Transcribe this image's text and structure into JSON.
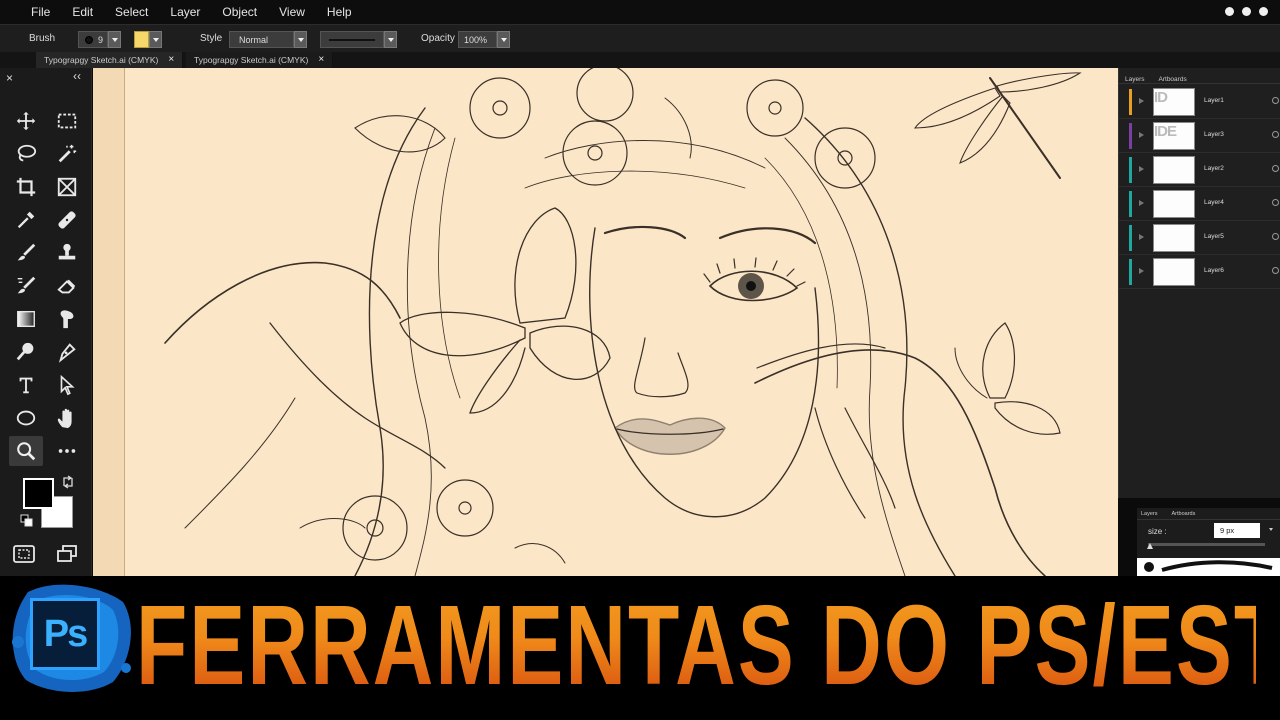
{
  "menu": {
    "items": [
      "File",
      "Edit",
      "Select",
      "Layer",
      "Object",
      "View",
      "Help"
    ]
  },
  "options_bar": {
    "brush_label": "Brush",
    "brush_size": "9",
    "brush_color": "#f7d76a",
    "style_label": "Style",
    "style_value": "Normal",
    "opacity_label": "Opacity",
    "opacity_value": "100%"
  },
  "tabs": [
    {
      "label": "Typograpgy Sketch.ai (CMYK)",
      "close": "×",
      "active": true
    },
    {
      "label": "Typograpgy Sketch.ai (CMYK)",
      "close": "×",
      "active": false
    }
  ],
  "toolbox": {
    "close_glyph": "×",
    "collapse_glyph": "‹‹",
    "tools": [
      "move-icon",
      "marquee-icon",
      "lasso-icon",
      "magic-wand-icon",
      "crop-icon",
      "frame-icon",
      "eyedropper-icon",
      "healing-icon",
      "brush-icon",
      "stamp-icon",
      "history-brush-icon",
      "eraser-icon",
      "gradient-icon",
      "smudge-icon",
      "dodge-icon",
      "pen-icon",
      "type-icon",
      "path-select-icon",
      "ellipse-icon",
      "hand-icon",
      "zoom-icon",
      "more-icon"
    ],
    "active_tool": "zoom-icon",
    "foreground_color": "#000000",
    "background_color": "#ffffff"
  },
  "layers_panel": {
    "tabs": [
      "Layers",
      "Artboards"
    ],
    "layers": [
      {
        "name": "Layer1",
        "color": "#e8a020",
        "thumb": "ID"
      },
      {
        "name": "Layer3",
        "color": "#7a3fa0",
        "thumb": "IDE"
      },
      {
        "name": "Layer2",
        "color": "#1fa8a0",
        "thumb": ""
      },
      {
        "name": "Layer4",
        "color": "#1fa8a0",
        "thumb": ""
      },
      {
        "name": "Layer5",
        "color": "#1fa8a0",
        "thumb": ""
      },
      {
        "name": "Layer6",
        "color": "#1fa8a0",
        "thumb": ""
      }
    ]
  },
  "brush_panel": {
    "tabs": [
      "Layers",
      "Artboards"
    ],
    "size_label": "size :",
    "size_value": "9 px"
  },
  "banner": {
    "title": "FERRAMENTAS DO PS/ESTAMPAS",
    "logo_text": "Ps",
    "title_color": "#f08a1a"
  }
}
